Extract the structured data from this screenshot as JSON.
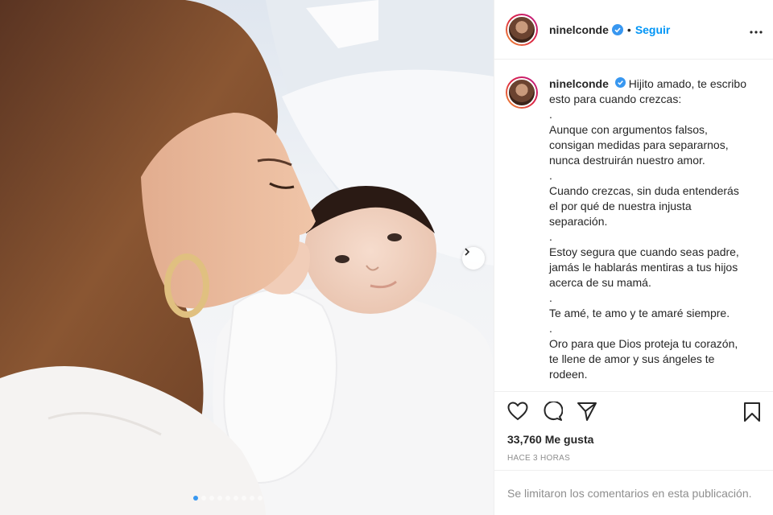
{
  "post": {
    "username": "ninelconde",
    "follow_label": "Seguir",
    "separator": "•",
    "caption_lines": [
      "Hijito amado, te escribo",
      "esto para cuando crezcas:",
      ".",
      "Aunque con argumentos falsos,",
      "consigan medidas para separarnos,",
      "nunca destruirán nuestro amor.",
      ".",
      "Cuando crezcas, sin duda entenderás",
      "el por qué de nuestra injusta",
      "separación.",
      ".",
      "Estoy segura que cuando seas padre,",
      "jamás le hablarás mentiras a tus hijos",
      "acerca de su mamá.",
      ".",
      "Te amé, te amo y te amaré siempre.",
      ".",
      "Oro para que Dios proteja tu corazón,",
      "te llene de amor y sus ángeles te",
      "rodeen."
    ],
    "likes": "33,760 Me gusta",
    "timestamp": "HACE 3 HORAS",
    "comments_disabled": "Se limitaron los comentarios en esta publicación."
  },
  "icons": {
    "like": "heart-icon",
    "comment": "comment-icon",
    "share": "share-icon",
    "save": "bookmark-icon",
    "more": "more-options-icon",
    "verified": "verified-badge-icon",
    "carousel_next": "chevron-right-icon"
  },
  "carousel": {
    "total_slides": 9,
    "active_index": 0
  },
  "colors": {
    "link": "#0095f6",
    "verified": "#3897f0",
    "muted": "#8e8e8e",
    "text": "#262626"
  }
}
